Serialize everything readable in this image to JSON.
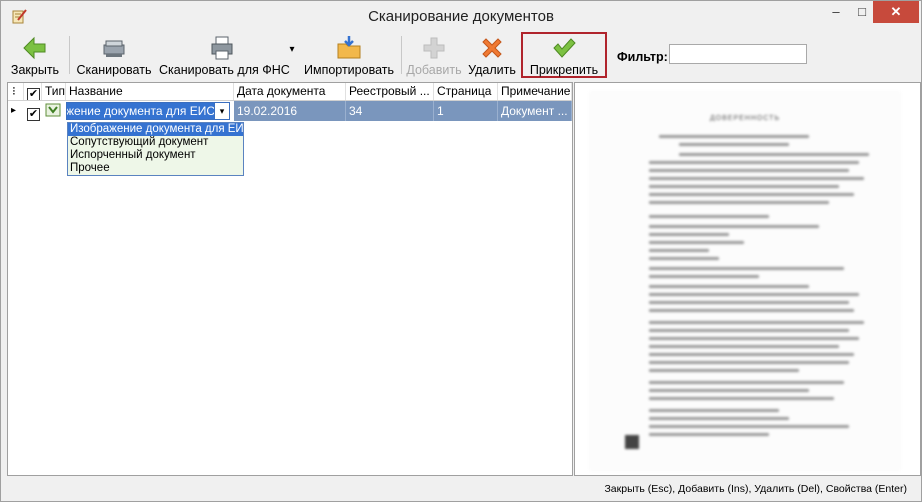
{
  "window": {
    "title": "Сканирование документов",
    "minimize": "–",
    "maximize": "□",
    "close": "✕"
  },
  "toolbar": {
    "close_label": "Закрыть",
    "scan_label": "Сканировать",
    "scan_fns_label": "Сканировать для ФНС",
    "scan_fns_dropdown": "▾",
    "import_label": "Импортировать",
    "add_label": "Добавить",
    "delete_label": "Удалить",
    "attach_label": "Прикрепить",
    "filter_label": "Фильтр:",
    "filter_value": ""
  },
  "grid": {
    "columns": {
      "menu": "⁝",
      "check": "✔",
      "type": "Тип",
      "name": "Название",
      "date": "Дата документа",
      "registry": "Реестровый ...",
      "page": "Страница",
      "note": "Примечание"
    },
    "rows": [
      {
        "indicator": "▸",
        "checked": "✔",
        "name": "Изображение документа для ЕИС",
        "date": "19.02.2016",
        "registry": "34",
        "page": "1",
        "note": "Документ ..."
      }
    ],
    "dropdown_arrow": "▾",
    "type_options": [
      "Изображение документа для ЕИС",
      "Сопутствующий документ",
      "Испорченный документ",
      "Прочее"
    ]
  },
  "preview": {
    "page_title": "ДОВЕРЕННОСТЬ"
  },
  "status": {
    "hint": "Закрыть (Esc), Добавить (Ins), Удалить (Del), Свойства (Enter)"
  },
  "colors": {
    "selection": "#3573d1",
    "row_selected": "#7a96bd",
    "highlight_border": "#b0242c",
    "close_button": "#c74a3c"
  }
}
